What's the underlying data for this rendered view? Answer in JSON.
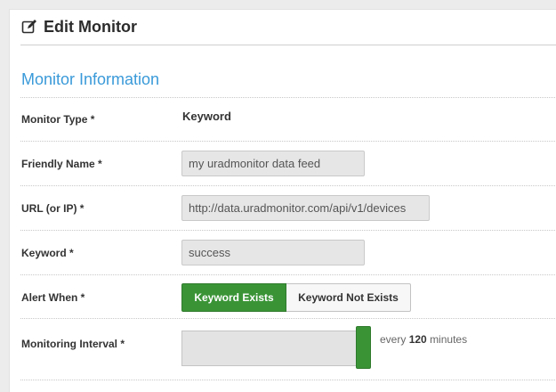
{
  "header": {
    "title": "Edit Monitor",
    "icon": "edit-icon"
  },
  "section": {
    "title": "Monitor Information"
  },
  "fields": {
    "monitor_type": {
      "label": "Monitor Type *",
      "value": "Keyword"
    },
    "friendly_name": {
      "label": "Friendly Name *",
      "value": "my uradmonitor data feed"
    },
    "url": {
      "label": "URL (or IP) *",
      "value": "http://data.uradmonitor.com/api/v1/devices"
    },
    "keyword": {
      "label": "Keyword *",
      "value": "success"
    },
    "alert_when": {
      "label": "Alert When *",
      "options": [
        "Keyword Exists",
        "Keyword Not Exists"
      ],
      "selected": "Keyword Exists"
    },
    "interval": {
      "label": "Monitoring Interval *",
      "prefix": "every",
      "value": "120",
      "unit": "minutes",
      "slider_level": 1.0
    }
  },
  "colors": {
    "accent_green": "#3a9436",
    "section_blue": "#3a9ad9",
    "field_bg": "#e6e6e6"
  }
}
